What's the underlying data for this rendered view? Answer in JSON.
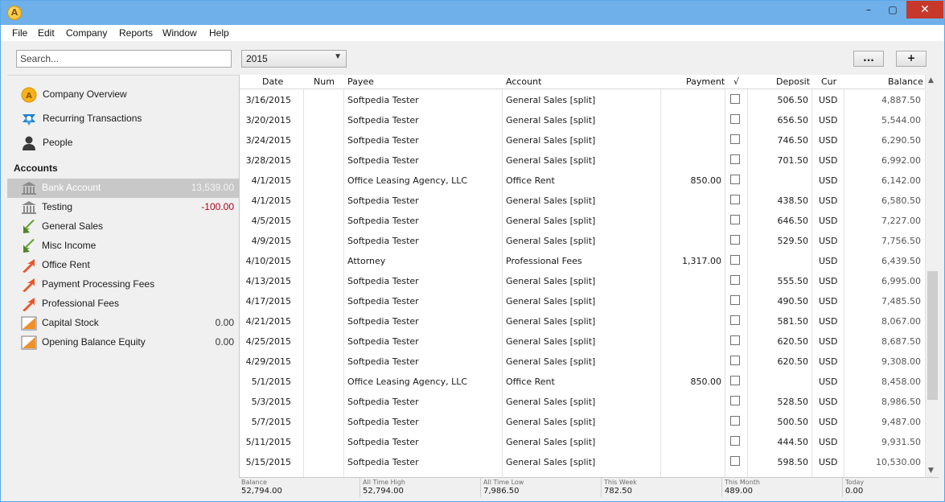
{
  "app": {
    "icon_letter": "A"
  },
  "window_controls": {
    "minimize": "–",
    "maximize": "▢",
    "close": "✕"
  },
  "menu": [
    "File",
    "Edit",
    "Company",
    "Reports",
    "Window",
    "Help"
  ],
  "toolbar": {
    "search_placeholder": "Search...",
    "year": "2015",
    "more_label": "...",
    "add_label": "+"
  },
  "sidebar": {
    "top_items": [
      {
        "label": "Company Overview",
        "icon": "company-icon"
      },
      {
        "label": "Recurring Transactions",
        "icon": "recurring-icon"
      },
      {
        "label": "People",
        "icon": "person-icon"
      }
    ],
    "accounts_heading": "Accounts",
    "accounts": [
      {
        "label": "Bank Account",
        "amount": "13,539.00",
        "icon": "bank-icon",
        "selected": true
      },
      {
        "label": "Testing",
        "amount": "-100.00",
        "icon": "bank-icon",
        "negative": true
      },
      {
        "label": "General Sales",
        "amount": "",
        "icon": "income-arrow-icon"
      },
      {
        "label": "Misc Income",
        "amount": "",
        "icon": "income-arrow-icon"
      },
      {
        "label": "Office Rent",
        "amount": "",
        "icon": "expense-arrow-icon"
      },
      {
        "label": "Payment Processing Fees",
        "amount": "",
        "icon": "expense-arrow-icon"
      },
      {
        "label": "Professional Fees",
        "amount": "",
        "icon": "expense-arrow-icon"
      },
      {
        "label": "Capital Stock",
        "amount": "0.00",
        "icon": "equity-icon"
      },
      {
        "label": "Opening Balance Equity",
        "amount": "0.00",
        "icon": "equity-icon"
      }
    ]
  },
  "register": {
    "columns": [
      "Date",
      "Num",
      "Payee",
      "Account",
      "Payment",
      "√",
      "Deposit",
      "Cur",
      "Balance"
    ],
    "rows": [
      [
        "3/16/2015",
        "",
        "Softpedia Tester",
        "General Sales [split]",
        "",
        "",
        "506.50",
        "USD",
        "4,887.50"
      ],
      [
        "3/20/2015",
        "",
        "Softpedia Tester",
        "General Sales [split]",
        "",
        "",
        "656.50",
        "USD",
        "5,544.00"
      ],
      [
        "3/24/2015",
        "",
        "Softpedia Tester",
        "General Sales [split]",
        "",
        "",
        "746.50",
        "USD",
        "6,290.50"
      ],
      [
        "3/28/2015",
        "",
        "Softpedia Tester",
        "General Sales [split]",
        "",
        "",
        "701.50",
        "USD",
        "6,992.00"
      ],
      [
        "4/1/2015",
        "",
        "Office Leasing Agency, LLC",
        "Office Rent",
        "850.00",
        "",
        "",
        "USD",
        "6,142.00"
      ],
      [
        "4/1/2015",
        "",
        "Softpedia Tester",
        "General Sales [split]",
        "",
        "",
        "438.50",
        "USD",
        "6,580.50"
      ],
      [
        "4/5/2015",
        "",
        "Softpedia Tester",
        "General Sales [split]",
        "",
        "",
        "646.50",
        "USD",
        "7,227.00"
      ],
      [
        "4/9/2015",
        "",
        "Softpedia Tester",
        "General Sales [split]",
        "",
        "",
        "529.50",
        "USD",
        "7,756.50"
      ],
      [
        "4/10/2015",
        "",
        "Attorney",
        "Professional Fees",
        "1,317.00",
        "",
        "",
        "USD",
        "6,439.50"
      ],
      [
        "4/13/2015",
        "",
        "Softpedia Tester",
        "General Sales [split]",
        "",
        "",
        "555.50",
        "USD",
        "6,995.00"
      ],
      [
        "4/17/2015",
        "",
        "Softpedia Tester",
        "General Sales [split]",
        "",
        "",
        "490.50",
        "USD",
        "7,485.50"
      ],
      [
        "4/21/2015",
        "",
        "Softpedia Tester",
        "General Sales [split]",
        "",
        "",
        "581.50",
        "USD",
        "8,067.00"
      ],
      [
        "4/25/2015",
        "",
        "Softpedia Tester",
        "General Sales [split]",
        "",
        "",
        "620.50",
        "USD",
        "8,687.50"
      ],
      [
        "4/29/2015",
        "",
        "Softpedia Tester",
        "General Sales [split]",
        "",
        "",
        "620.50",
        "USD",
        "9,308.00"
      ],
      [
        "5/1/2015",
        "",
        "Office Leasing Agency, LLC",
        "Office Rent",
        "850.00",
        "",
        "",
        "USD",
        "8,458.00"
      ],
      [
        "5/3/2015",
        "",
        "Softpedia Tester",
        "General Sales [split]",
        "",
        "",
        "528.50",
        "USD",
        "8,986.50"
      ],
      [
        "5/7/2015",
        "",
        "Softpedia Tester",
        "General Sales [split]",
        "",
        "",
        "500.50",
        "USD",
        "9,487.00"
      ],
      [
        "5/11/2015",
        "",
        "Softpedia Tester",
        "General Sales [split]",
        "",
        "",
        "444.50",
        "USD",
        "9,931.50"
      ],
      [
        "5/15/2015",
        "",
        "Softpedia Tester",
        "General Sales [split]",
        "",
        "",
        "598.50",
        "USD",
        "10,530.00"
      ]
    ]
  },
  "footer": [
    {
      "label": "Balance",
      "value": "52,794.00"
    },
    {
      "label": "All Time High",
      "value": "52,794.00"
    },
    {
      "label": "All Time Low",
      "value": "7,986.50"
    },
    {
      "label": "This Week",
      "value": "782.50"
    },
    {
      "label": "This Month",
      "value": "489.00"
    },
    {
      "label": "Today",
      "value": "0.00"
    }
  ],
  "colors": {
    "titlebar": "#6fb0ea",
    "close": "#c7382b",
    "selected_row": "#c8c8c8",
    "negative": "#b0001e",
    "income_arrow": "#6aa13b",
    "expense_arrow": "#e8572a"
  }
}
